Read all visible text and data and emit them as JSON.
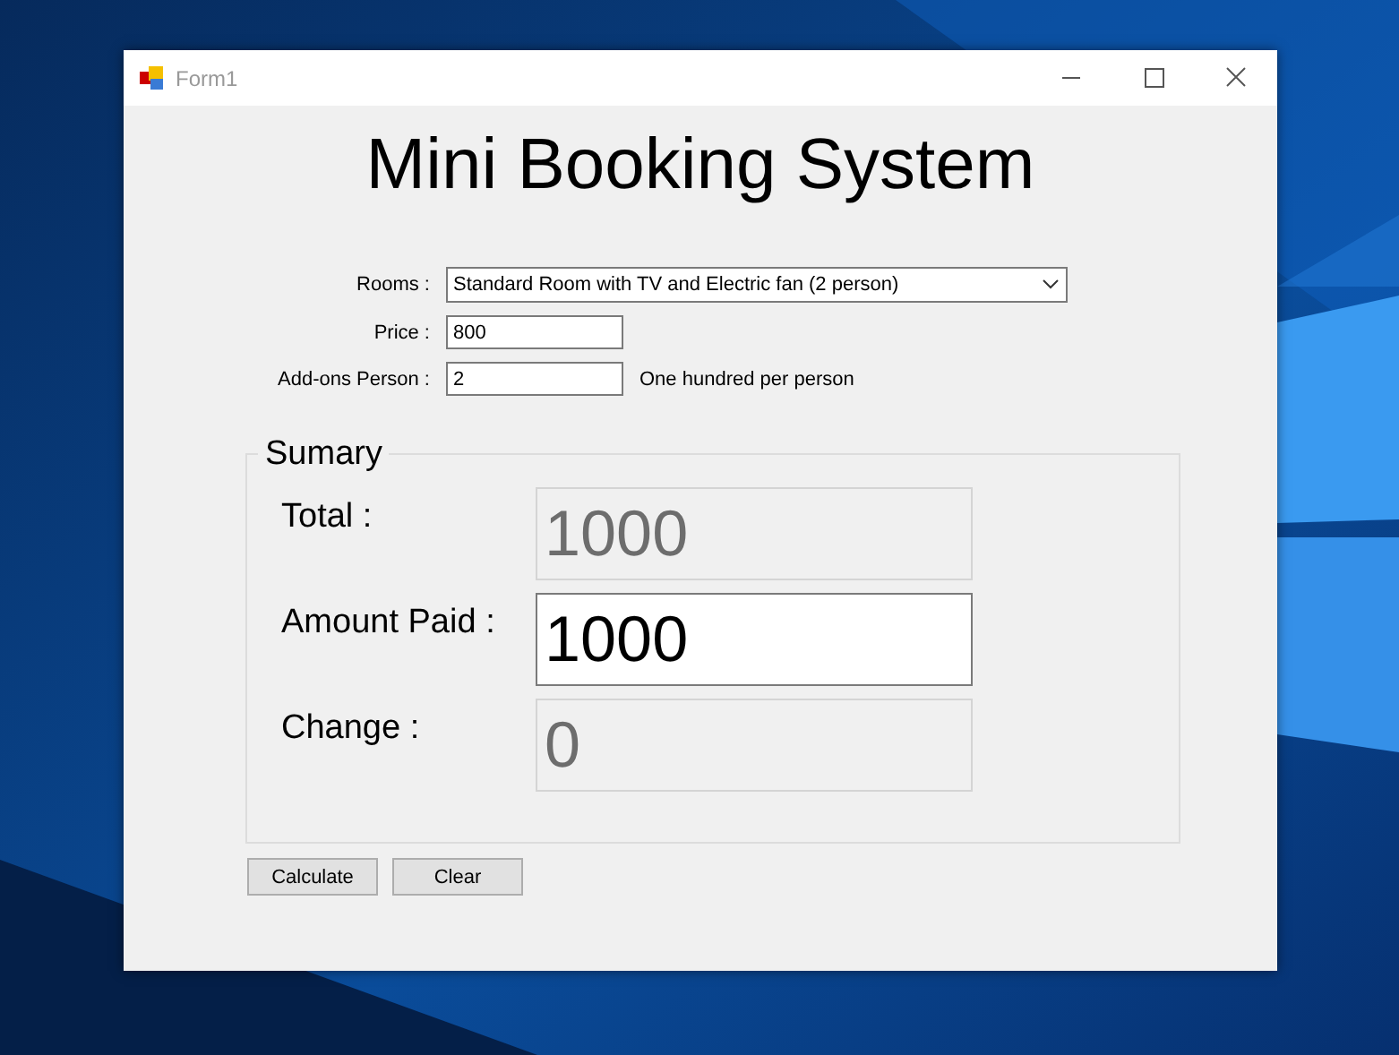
{
  "window": {
    "title": "Form1"
  },
  "heading": "Mini Booking System",
  "form": {
    "rooms_label": "Rooms :",
    "rooms_value": "Standard Room with TV and Electric fan (2 person)",
    "price_label": "Price :",
    "price_value": "800",
    "addons_label": "Add-ons Person :",
    "addons_value": "2",
    "addons_note": "One hundred per person"
  },
  "summary": {
    "title": "Sumary",
    "rows": [
      {
        "label": "Total :",
        "value": "1000",
        "disabled": true
      },
      {
        "label": "Amount Paid :",
        "value": "1000",
        "disabled": false
      },
      {
        "label": "Change :",
        "value": "0",
        "disabled": true
      }
    ]
  },
  "buttons": [
    "Calculate",
    "Clear"
  ]
}
